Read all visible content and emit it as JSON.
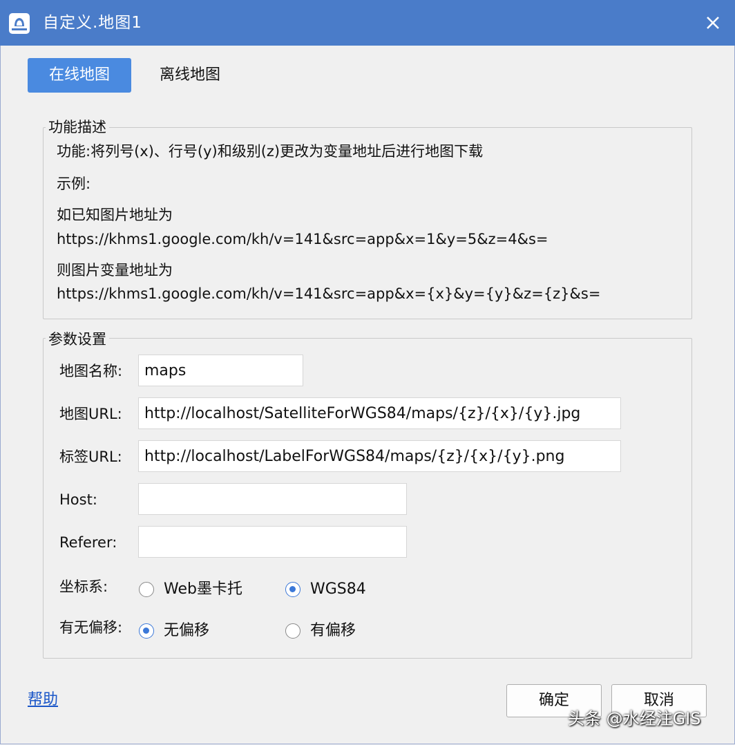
{
  "window": {
    "title": "自定义.地图1",
    "app_icon": "map-app-icon",
    "close_icon": "close-icon"
  },
  "tabs": [
    {
      "label": "在线地图",
      "active": true
    },
    {
      "label": "离线地图",
      "active": false
    }
  ],
  "description": {
    "legend": "功能描述",
    "lines": [
      "功能:将列号(x)、行号(y)和级别(z)更改为变量地址后进行地图下载",
      "示例:",
      "如已知图片地址为",
      "https://khms1.google.com/kh/v=141&src=app&x=1&y=5&z=4&s=",
      "则图片变量地址为",
      "https://khms1.google.com/kh/v=141&src=app&x={x}&y={y}&z={z}&s="
    ]
  },
  "params": {
    "legend": "参数设置",
    "map_name": {
      "label": "地图名称:",
      "value": "maps"
    },
    "map_url": {
      "label": "地图URL:",
      "value": "http://localhost/SatelliteForWGS84/maps/{z}/{x}/{y}.jpg"
    },
    "label_url": {
      "label": "标签URL:",
      "value": "http://localhost/LabelForWGS84/maps/{z}/{x}/{y}.png"
    },
    "host": {
      "label": "Host:",
      "value": ""
    },
    "referer": {
      "label": "Referer:",
      "value": ""
    },
    "coord_system": {
      "label": "坐标系:",
      "options": [
        {
          "label": "Web墨卡托",
          "checked": false
        },
        {
          "label": "WGS84",
          "checked": true
        }
      ]
    },
    "offset": {
      "label": "有无偏移:",
      "options": [
        {
          "label": "无偏移",
          "checked": true
        },
        {
          "label": "有偏移",
          "checked": false
        }
      ]
    }
  },
  "footer": {
    "help": "帮助",
    "ok": "确定",
    "cancel": "取消"
  },
  "watermark": "头条 @水经注GIS",
  "colors": {
    "titlebar": "#4a7cc9",
    "active_tab": "#4a8ae0",
    "radio_accent": "#3b78d8",
    "link": "#1a56c8"
  }
}
